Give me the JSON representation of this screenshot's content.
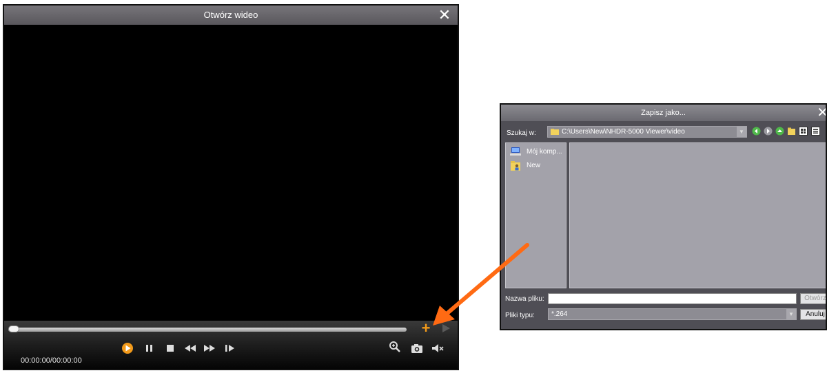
{
  "player": {
    "title": "Otwórz wideo",
    "close_icon": "close-icon",
    "time": "00:00:00/00:00:00",
    "controls": [
      "play-icon",
      "pause-icon",
      "stop-icon",
      "rewind-icon",
      "fast-forward-icon",
      "step-forward-icon"
    ],
    "right_tools": [
      "zoom-icon",
      "camera-icon",
      "mute-icon"
    ],
    "accent": "#f29a1a"
  },
  "dialog": {
    "title": "Zapisz jako...",
    "look_in_label": "Szukaj w:",
    "path": "C:\\Users\\New\\NHDR-5000 Viewer\\video",
    "places": [
      {
        "label": "Mój komp...",
        "icon": "computer-icon"
      },
      {
        "label": "New",
        "icon": "user-folder-icon"
      }
    ],
    "filename_label": "Nazwa pliku:",
    "filename_value": "",
    "filetype_label": "Pliki typu:",
    "filetype_value": "*.264",
    "open_button": "Otwórz",
    "cancel_button": "Anuluj"
  },
  "annotation": {
    "arrow_color": "#ff6a13"
  }
}
